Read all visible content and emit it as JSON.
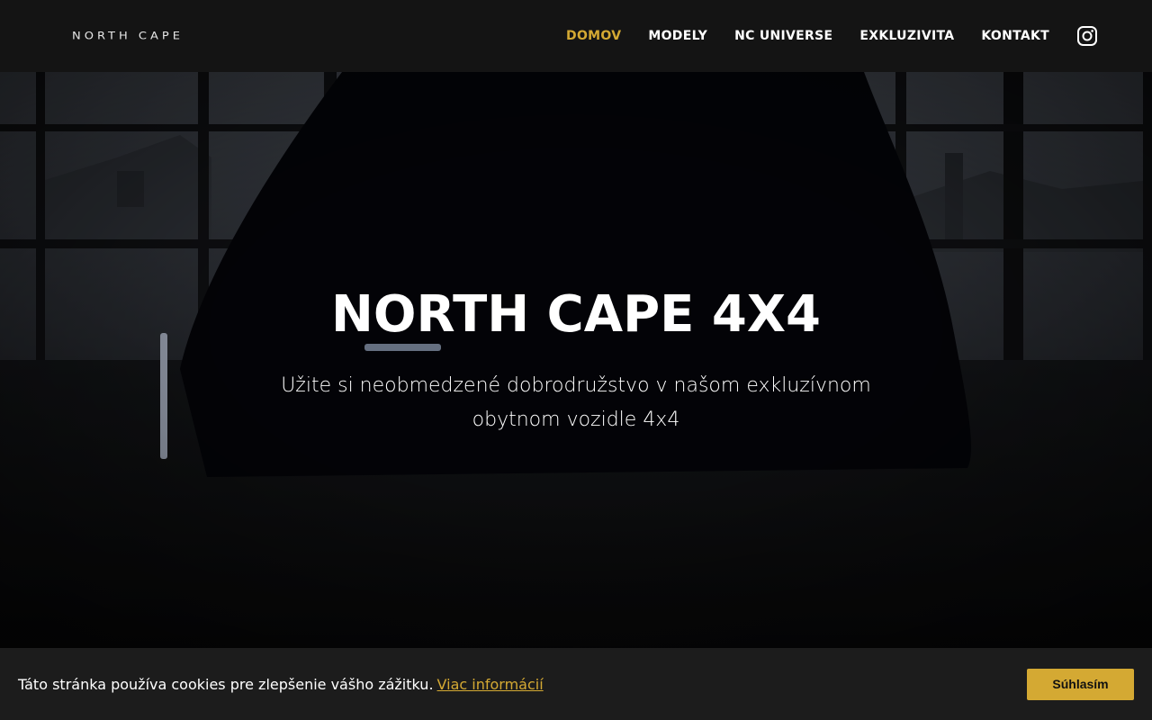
{
  "header": {
    "logo_text": "NORTH CAPE",
    "nav": [
      {
        "label": "DOMOV",
        "active": true
      },
      {
        "label": "MODELY",
        "active": false
      },
      {
        "label": "NC UNIVERSE",
        "active": false
      },
      {
        "label": "EXKLUZIVITA",
        "active": false
      },
      {
        "label": "KONTAKT",
        "active": false
      }
    ],
    "social_icon": "instagram-icon"
  },
  "hero": {
    "title": "NORTH CAPE 4X4",
    "subtitle": "Užite si neobmedzené dobrodružstvo v našom exkluzívnom obytnom vozidle 4x4"
  },
  "cookie_bar": {
    "text": "Táto stránka používa cookies pre zlepšenie vášho zážitku.",
    "link_label": "Viac informácií",
    "accept_label": "Súhlasím"
  },
  "colors": {
    "accent": "#d4a933",
    "header_bg": "#141414",
    "cookie_bg": "#1c1c1c"
  }
}
